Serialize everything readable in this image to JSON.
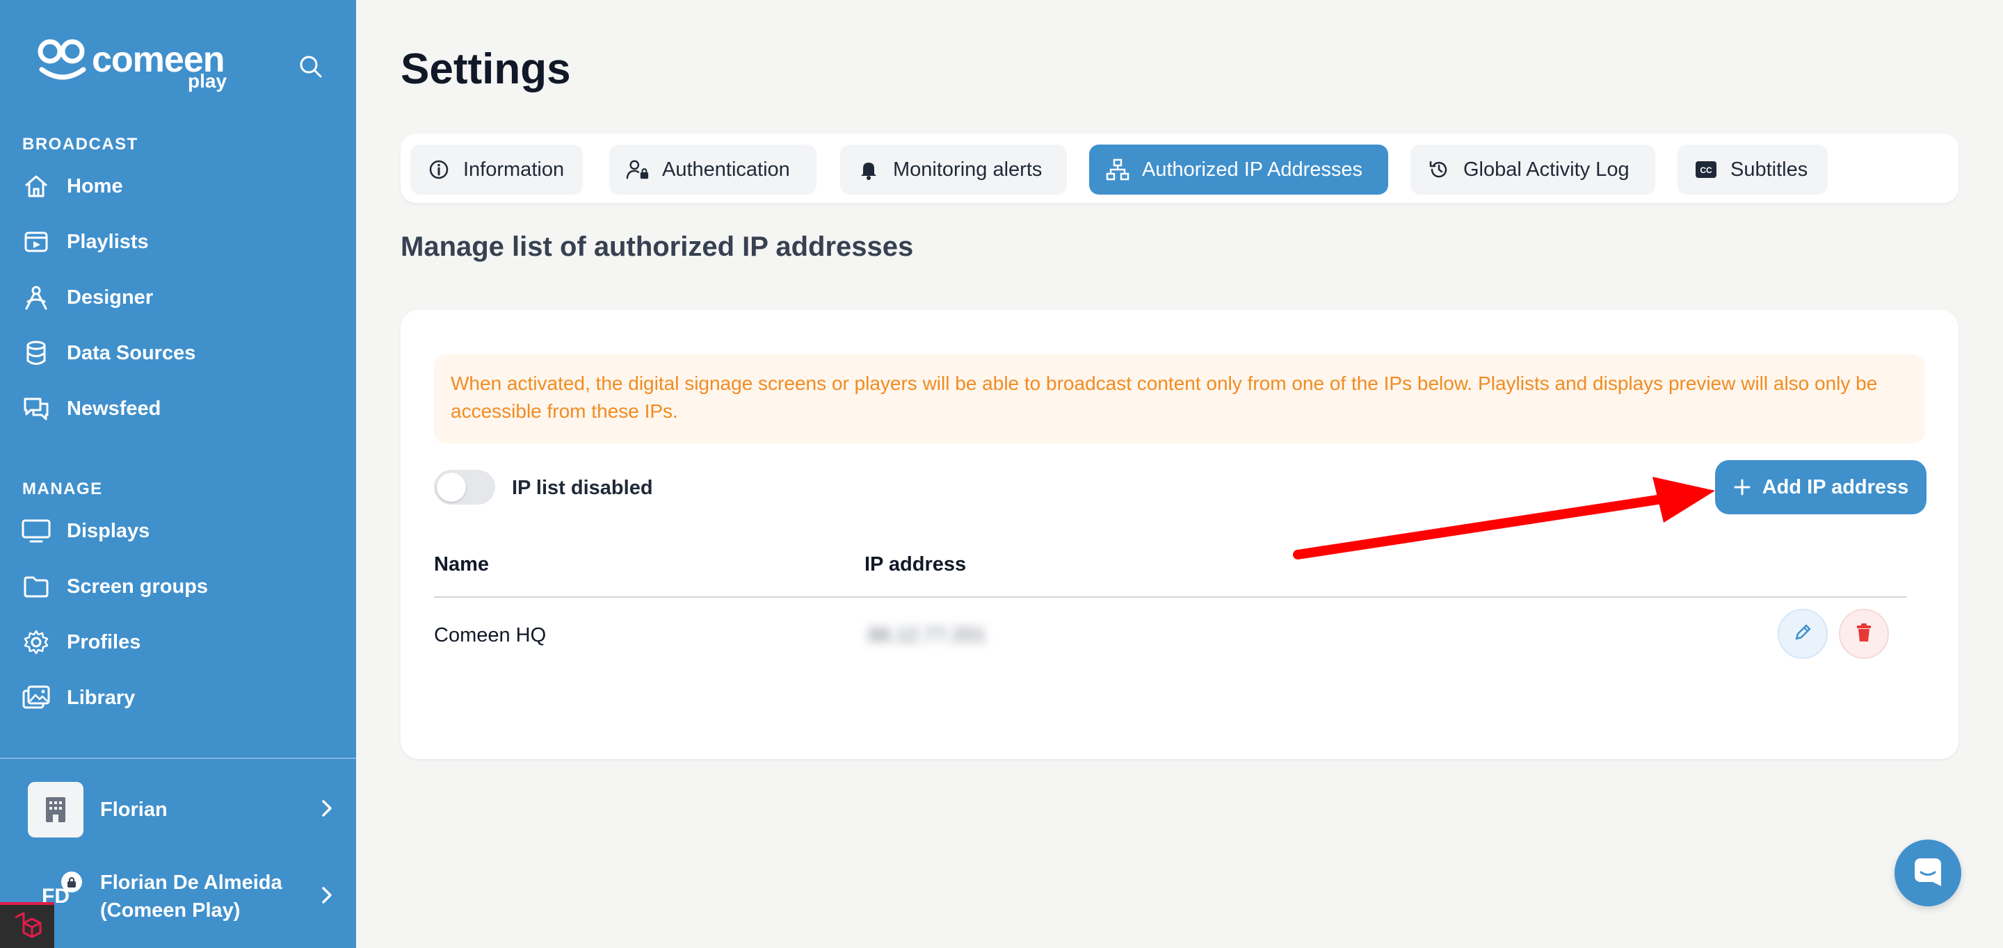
{
  "brand": {
    "name": "comeen",
    "sub": "play"
  },
  "sidebar": {
    "broadcast_label": "BROADCAST",
    "broadcast_items": [
      {
        "label": "Home",
        "icon": "home-icon"
      },
      {
        "label": "Playlists",
        "icon": "playlist-icon"
      },
      {
        "label": "Designer",
        "icon": "designer-icon"
      },
      {
        "label": "Data Sources",
        "icon": "database-icon"
      },
      {
        "label": "Newsfeed",
        "icon": "chat-bubbles-icon"
      }
    ],
    "manage_label": "MANAGE",
    "manage_items": [
      {
        "label": "Displays",
        "icon": "monitor-icon"
      },
      {
        "label": "Screen groups",
        "icon": "folder-icon"
      },
      {
        "label": "Profiles",
        "icon": "gear-icon"
      },
      {
        "label": "Library",
        "icon": "images-icon"
      }
    ],
    "org": {
      "name": "Florian"
    },
    "user": {
      "initials": "FD",
      "name_line1": "Florian De Almeida",
      "name_line2": "(Comeen Play)"
    }
  },
  "page": {
    "title": "Settings",
    "subtitle": "Manage list of authorized IP addresses"
  },
  "tabs": [
    {
      "label": "Information",
      "icon": "info-icon"
    },
    {
      "label": "Authentication",
      "icon": "user-lock-icon"
    },
    {
      "label": "Monitoring alerts",
      "icon": "bell-icon"
    },
    {
      "label": "Authorized IP Addresses",
      "icon": "network-icon",
      "active": true
    },
    {
      "label": "Global Activity Log",
      "icon": "history-icon"
    },
    {
      "label": "Subtitles",
      "icon": "closed-caption-icon"
    }
  ],
  "alert": {
    "text": "When activated, the digital signage screens or players will be able to broadcast content only from one of the IPs below. Playlists and displays preview will also only be accessible from these IPs."
  },
  "ip_toggle": {
    "label": "IP list disabled",
    "enabled": false
  },
  "add_button": {
    "label": "Add IP address"
  },
  "table": {
    "columns": [
      "Name",
      "IP address"
    ],
    "rows": [
      {
        "name": "Comeen HQ",
        "ip": "88.12.77.201"
      }
    ]
  },
  "colors": {
    "primary": "#4090cc",
    "alert_text": "#f08c22",
    "alert_bg": "#fff6ed",
    "danger": "#e53935",
    "annotation_arrow": "#ff0000"
  }
}
